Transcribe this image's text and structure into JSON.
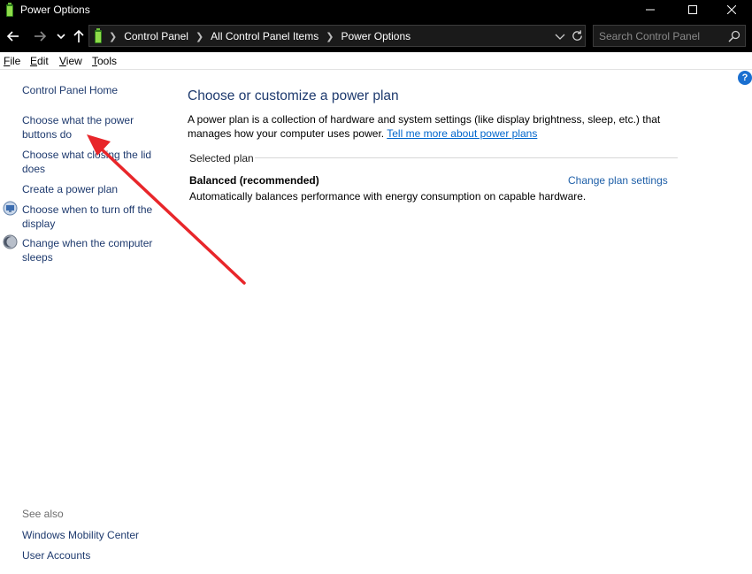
{
  "window": {
    "title": "Power Options"
  },
  "address": {
    "crumbs": [
      "Control Panel",
      "All Control Panel Items",
      "Power Options"
    ]
  },
  "search": {
    "placeholder": "Search Control Panel"
  },
  "menu": {
    "file_u": "F",
    "file_rest": "ile",
    "edit_u": "E",
    "edit_rest": "dit",
    "view_u": "V",
    "view_rest": "iew",
    "tools_u": "T",
    "tools_rest": "ools"
  },
  "help": {
    "glyph": "?"
  },
  "sidebar": {
    "home": "Control Panel Home",
    "items": [
      "Choose what the power buttons do",
      "Choose what closing the lid does",
      "Create a power plan",
      "Choose when to turn off the display",
      "Change when the computer sleeps"
    ]
  },
  "see_also": {
    "title": "See also",
    "items": [
      "Windows Mobility Center",
      "User Accounts"
    ]
  },
  "main": {
    "title": "Choose or customize a power plan",
    "description": "A power plan is a collection of hardware and system settings (like display brightness, sleep, etc.) that manages how your computer uses power.",
    "learn_more": "Tell me more about power plans",
    "section_label": "Selected plan",
    "plan_name": "Balanced (recommended)",
    "plan_settings_link": "Change plan settings",
    "plan_description": "Automatically balances performance with energy consumption on capable hardware."
  },
  "colors": {
    "annotation_arrow": "#e8262a",
    "link": "#1e3a6e",
    "title_blue": "#1e3a6e",
    "help_blue": "#1a6fd0"
  }
}
